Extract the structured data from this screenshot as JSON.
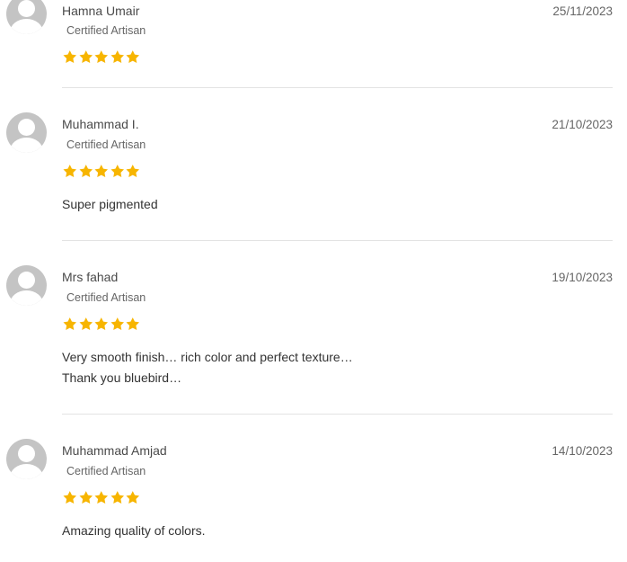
{
  "reviews": [
    {
      "name": "Hamna Umair",
      "badge": "Certified Artisan",
      "date": "25/11/2023",
      "rating": 5,
      "text": []
    },
    {
      "name": "Muhammad I.",
      "badge": "Certified Artisan",
      "date": "21/10/2023",
      "rating": 5,
      "text": [
        "Super pigmented"
      ]
    },
    {
      "name": "Mrs fahad",
      "badge": "Certified Artisan",
      "date": "19/10/2023",
      "rating": 5,
      "text": [
        "Very smooth finish… rich color and perfect texture…",
        "Thank you bluebird…"
      ]
    },
    {
      "name": "Muhammad Amjad",
      "badge": "Certified Artisan",
      "date": "14/10/2023",
      "rating": 5,
      "text": [
        "Amazing quality of colors."
      ]
    }
  ],
  "colors": {
    "star": "#f7b500",
    "avatar": "#c4c4c4",
    "divider": "#e3e3e3"
  },
  "icons": {
    "avatar": "user-avatar-icon",
    "star": "star-icon"
  }
}
